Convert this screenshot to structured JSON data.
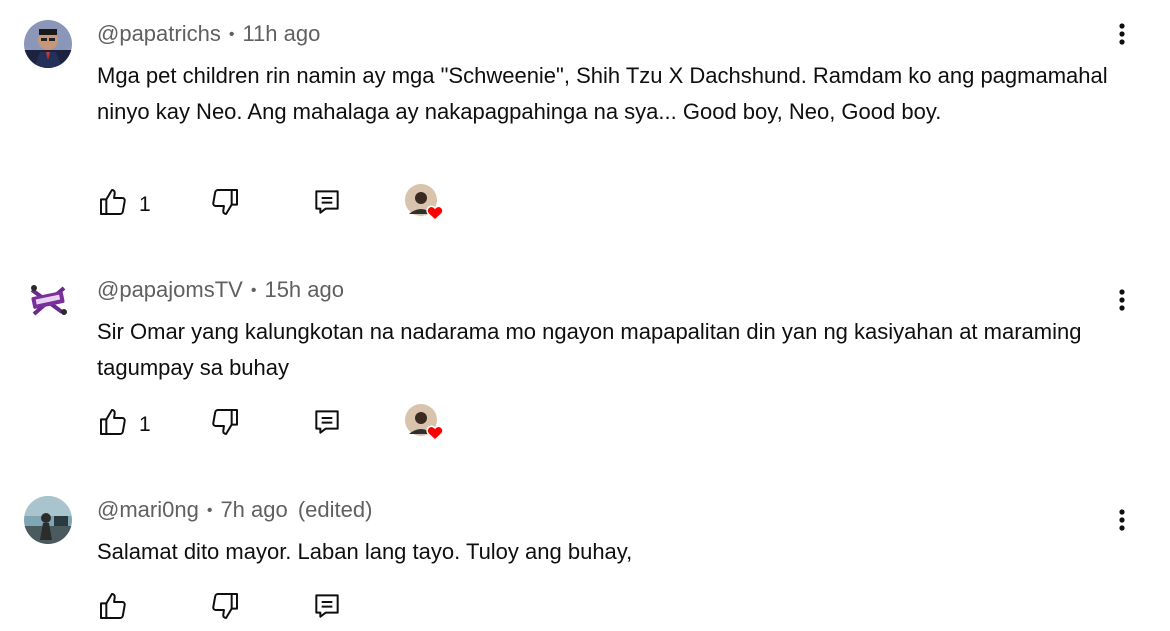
{
  "comments": [
    {
      "author": "@papatrichs",
      "time": "11h ago",
      "edited": "",
      "text": "Mga pet children rin namin ay mga \"Schweenie\", Shih Tzu X Dachshund. Ramdam ko ang pagmamahal ninyo kay Neo. Ang mahalaga ay nakapagpahinga na sya... Good boy, Neo, Good boy.",
      "likes": "1",
      "hearted": true
    },
    {
      "author": "@papajomsTV",
      "time": "15h ago",
      "edited": "",
      "text": "Sir Omar yang kalungkotan na nadarama mo ngayon mapapalitan din yan ng kasiyahan at maraming tagumpay sa buhay",
      "likes": "1",
      "hearted": true
    },
    {
      "author": "@mari0ng",
      "time": "7h ago",
      "edited": "(edited)",
      "text": "Salamat dito mayor. Laban lang tayo. Tuloy ang buhay,",
      "likes": "",
      "hearted": false
    }
  ],
  "icons": {
    "like": "thumbs-up-icon",
    "dislike": "thumbs-down-icon",
    "reply": "reply-icon",
    "more": "more-vert-icon",
    "heart": "creator-heart-icon"
  },
  "colors": {
    "meta": "#606060",
    "text": "#0f0f0f",
    "heart": "#ff0000"
  }
}
